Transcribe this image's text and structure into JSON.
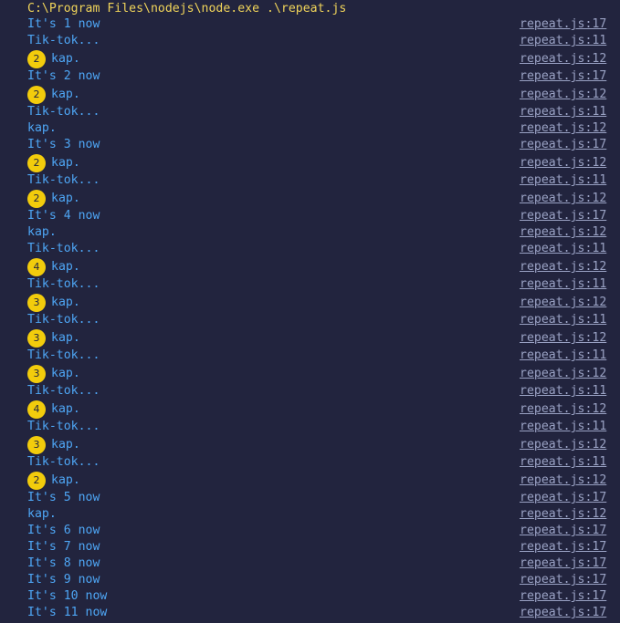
{
  "terminal": {
    "command": "C:\\Program Files\\nodejs\\node.exe .\\repeat.js"
  },
  "lines": [
    {
      "text": "It's 1 now",
      "count": "",
      "source": "repeat.js:17"
    },
    {
      "text": "Tik-tok...",
      "count": "",
      "source": "repeat.js:11"
    },
    {
      "text": "kap.",
      "count": "2",
      "source": "repeat.js:12"
    },
    {
      "text": "It's 2 now",
      "count": "",
      "source": "repeat.js:17"
    },
    {
      "text": "kap.",
      "count": "2",
      "source": "repeat.js:12"
    },
    {
      "text": "Tik-tok...",
      "count": "",
      "source": "repeat.js:11"
    },
    {
      "text": "kap.",
      "count": "",
      "source": "repeat.js:12"
    },
    {
      "text": "It's 3 now",
      "count": "",
      "source": "repeat.js:17"
    },
    {
      "text": "kap.",
      "count": "2",
      "source": "repeat.js:12"
    },
    {
      "text": "Tik-tok...",
      "count": "",
      "source": "repeat.js:11"
    },
    {
      "text": "kap.",
      "count": "2",
      "source": "repeat.js:12"
    },
    {
      "text": "It's 4 now",
      "count": "",
      "source": "repeat.js:17"
    },
    {
      "text": "kap.",
      "count": "",
      "source": "repeat.js:12"
    },
    {
      "text": "Tik-tok...",
      "count": "",
      "source": "repeat.js:11"
    },
    {
      "text": "kap.",
      "count": "4",
      "source": "repeat.js:12"
    },
    {
      "text": "Tik-tok...",
      "count": "",
      "source": "repeat.js:11"
    },
    {
      "text": "kap.",
      "count": "3",
      "source": "repeat.js:12"
    },
    {
      "text": "Tik-tok...",
      "count": "",
      "source": "repeat.js:11"
    },
    {
      "text": "kap.",
      "count": "3",
      "source": "repeat.js:12"
    },
    {
      "text": "Tik-tok...",
      "count": "",
      "source": "repeat.js:11"
    },
    {
      "text": "kap.",
      "count": "3",
      "source": "repeat.js:12"
    },
    {
      "text": "Tik-tok...",
      "count": "",
      "source": "repeat.js:11"
    },
    {
      "text": "kap.",
      "count": "4",
      "source": "repeat.js:12"
    },
    {
      "text": "Tik-tok...",
      "count": "",
      "source": "repeat.js:11"
    },
    {
      "text": "kap.",
      "count": "3",
      "source": "repeat.js:12"
    },
    {
      "text": "Tik-tok...",
      "count": "",
      "source": "repeat.js:11"
    },
    {
      "text": "kap.",
      "count": "2",
      "source": "repeat.js:12"
    },
    {
      "text": "It's 5 now",
      "count": "",
      "source": "repeat.js:17"
    },
    {
      "text": "kap.",
      "count": "",
      "source": "repeat.js:12"
    },
    {
      "text": "It's 6 now",
      "count": "",
      "source": "repeat.js:17"
    },
    {
      "text": "It's 7 now",
      "count": "",
      "source": "repeat.js:17"
    },
    {
      "text": "It's 8 now",
      "count": "",
      "source": "repeat.js:17"
    },
    {
      "text": "It's 9 now",
      "count": "",
      "source": "repeat.js:17"
    },
    {
      "text": "It's 10 now",
      "count": "",
      "source": "repeat.js:17"
    },
    {
      "text": "It's 11 now",
      "count": "",
      "source": "repeat.js:17"
    }
  ],
  "colors": {
    "background": "#22243e",
    "message": "#4ea6f5",
    "command": "#f0d45a",
    "badge": "#f2cc0c",
    "source_link": "#9aa2c4"
  }
}
